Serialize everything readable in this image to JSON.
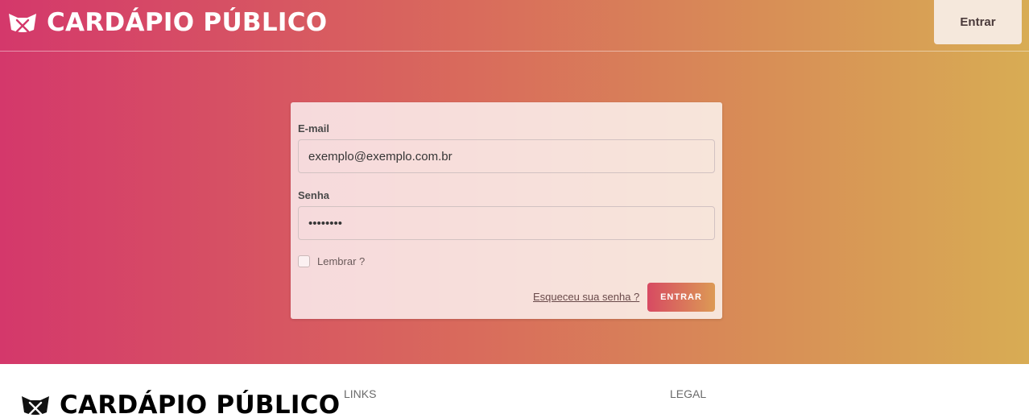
{
  "header": {
    "brand_title": "CARDÁPIO PÚBLICO",
    "brand_icon": "mask-cutlery-icon",
    "login_button": "Entrar"
  },
  "login_form": {
    "email_label": "E-mail",
    "email_value": "exemplo@exemplo.com.br",
    "password_label": "Senha",
    "password_value": "••••••••",
    "remember_label": "Lembrar ?",
    "remember_checked": false,
    "forgot_link": "Esqueceu sua senha ?",
    "submit_button": "ENTRAR"
  },
  "footer": {
    "brand_title": "CARDÁPIO PÚBLICO",
    "links_heading": "LINKS",
    "legal_heading": "LEGAL"
  },
  "colors": {
    "gradient_start": "#d4386b",
    "gradient_end": "#d8ac54",
    "card_background": "#f5dcd8",
    "header_button_background": "#f5e8dc"
  }
}
